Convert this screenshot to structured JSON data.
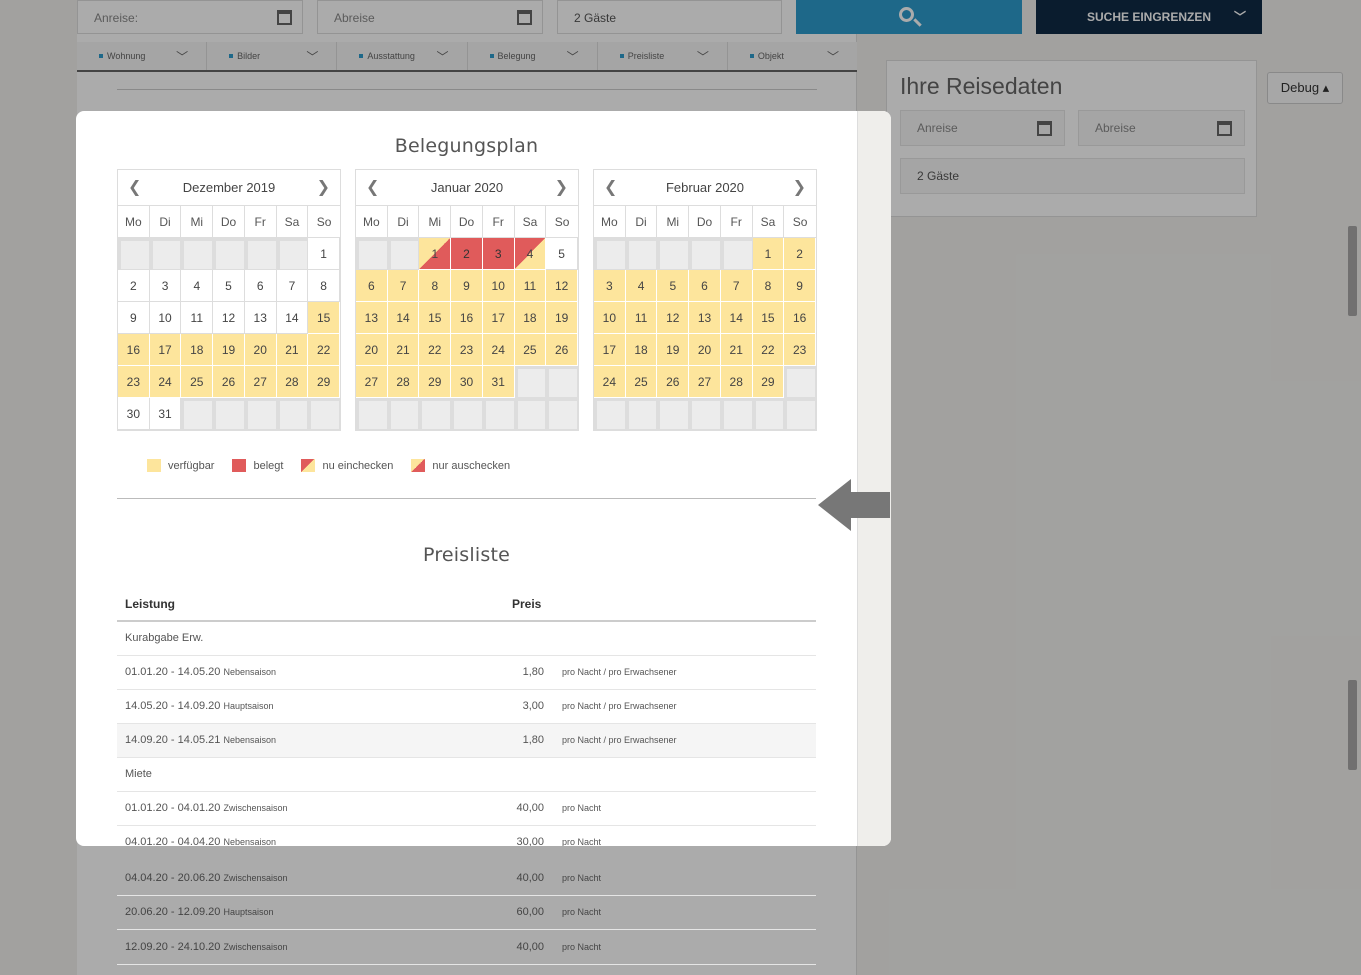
{
  "search_bar": {
    "arrival_placeholder": "Anreise:",
    "departure_placeholder": "Abreise",
    "guests_value": "2 Gäste",
    "refine_label": "SUCHE EINGRENZEN",
    "search_icon": "magnifier-icon",
    "calendar_icon": "calendar-icon",
    "chevron_icon": "chevron-down-icon"
  },
  "content_tabs": [
    {
      "label": "Wohnung"
    },
    {
      "label": "Bilder"
    },
    {
      "label": "Ausstattung"
    },
    {
      "label": "Belegung"
    },
    {
      "label": "Preisliste"
    },
    {
      "label": "Objekt"
    }
  ],
  "side_panel": {
    "title": "Ihre Reisedaten",
    "arrival_placeholder": "Anreise",
    "departure_placeholder": "Abreise",
    "guests_value": "2 Gäste"
  },
  "debug_button": {
    "label": "Debug ▴"
  },
  "occupancy": {
    "title": "Belegungsplan",
    "weekdays": [
      "Mo",
      "Di",
      "Mi",
      "Do",
      "Fr",
      "Sa",
      "So"
    ],
    "months": [
      {
        "name": "Dezember 2019",
        "offset": 6,
        "days": 31,
        "available": [
          15,
          16,
          17,
          18,
          19,
          20,
          21,
          22,
          23,
          24,
          25,
          26,
          27,
          28,
          29
        ],
        "booked": [],
        "checkin_only": [],
        "checkout_only": []
      },
      {
        "name": "Januar 2020",
        "offset": 2,
        "days": 31,
        "available": [
          6,
          7,
          8,
          9,
          10,
          11,
          12,
          13,
          14,
          15,
          16,
          17,
          18,
          19,
          20,
          21,
          22,
          23,
          24,
          25,
          26,
          27,
          28,
          29,
          30,
          31
        ],
        "booked": [
          2,
          3
        ],
        "checkin_only": [
          1
        ],
        "checkout_only": [
          4
        ]
      },
      {
        "name": "Februar 2020",
        "offset": 5,
        "days": 29,
        "available": [
          1,
          2,
          3,
          4,
          5,
          6,
          7,
          8,
          9,
          10,
          11,
          12,
          13,
          14,
          15,
          16,
          17,
          18,
          19,
          20,
          21,
          22,
          23,
          24,
          25,
          26,
          27,
          28,
          29
        ],
        "booked": [],
        "checkin_only": [],
        "checkout_only": []
      }
    ],
    "legend": {
      "available": "verfügbar",
      "booked": "belegt",
      "checkin": "nu einchecken",
      "checkout": "nur auschecken"
    },
    "colors": {
      "available": "#fde59c",
      "booked": "#e05b5b",
      "empty": "#ececec"
    }
  },
  "price_list": {
    "title": "Preisliste",
    "headers": {
      "service": "Leistung",
      "price": "Preis"
    },
    "rows": [
      {
        "type": "group",
        "label": "Kurabgabe Erw."
      },
      {
        "type": "item",
        "period": "01.01.20 - 14.05.20",
        "season": "Nebensaison",
        "price": "1,80",
        "unit": "pro Nacht / pro Erwachsener"
      },
      {
        "type": "item",
        "period": "14.05.20 - 14.09.20",
        "season": "Hauptsaison",
        "price": "3,00",
        "unit": "pro Nacht / pro Erwachsener"
      },
      {
        "type": "item",
        "period": "14.09.20 - 14.05.21",
        "season": "Nebensaison",
        "price": "1,80",
        "unit": "pro Nacht / pro Erwachsener",
        "alt": true
      },
      {
        "type": "group",
        "label": "Miete"
      },
      {
        "type": "item",
        "period": "01.01.20 - 04.01.20",
        "season": "Zwischensaison",
        "price": "40,00",
        "unit": "pro Nacht"
      },
      {
        "type": "item",
        "period": "04.01.20 - 04.04.20",
        "season": "Nebensaison",
        "price": "30,00",
        "unit": "pro Nacht"
      },
      {
        "type": "item",
        "period": "04.04.20 - 20.06.20",
        "season": "Zwischensaison",
        "price": "40,00",
        "unit": "pro Nacht"
      },
      {
        "type": "item",
        "period": "20.06.20 - 12.09.20",
        "season": "Hauptsaison",
        "price": "60,00",
        "unit": "pro Nacht"
      },
      {
        "type": "item",
        "period": "12.09.20 - 24.10.20",
        "season": "Zwischensaison",
        "price": "40,00",
        "unit": "pro Nacht"
      }
    ]
  },
  "modal_close_icon": "arrow-left-icon"
}
